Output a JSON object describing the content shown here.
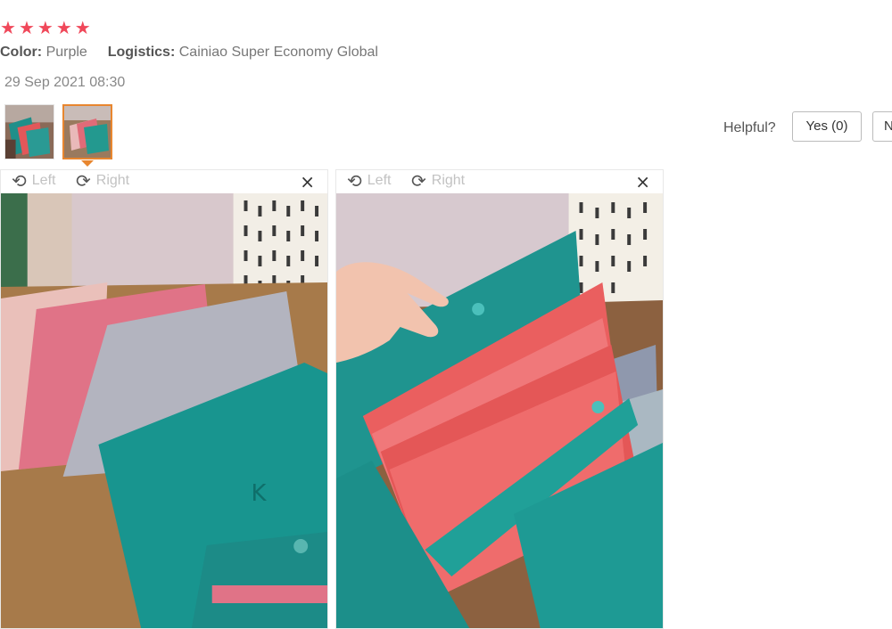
{
  "review": {
    "rating": 5,
    "stars": [
      "★",
      "★",
      "★",
      "★",
      "★"
    ],
    "color_key": "Color:",
    "color_value": "Purple",
    "logistics_key": "Logistics:",
    "logistics_value": "Cainiao Super Economy Global",
    "date": "29 Sep 2021 08:30"
  },
  "helpful": {
    "label": "Helpful?",
    "yes": "Yes (0)",
    "no": "N"
  },
  "viewers": [
    {
      "left_label": "Left",
      "right_label": "Right",
      "close": "×"
    },
    {
      "left_label": "Left",
      "right_label": "Right",
      "close": "×"
    }
  ],
  "icons": {
    "rotate_left": "⟲",
    "rotate_right": "⟳",
    "close": "close-icon",
    "star": "star-icon"
  },
  "colors": {
    "star": "#f0485a",
    "thumb_active_border": "#e8862f"
  }
}
